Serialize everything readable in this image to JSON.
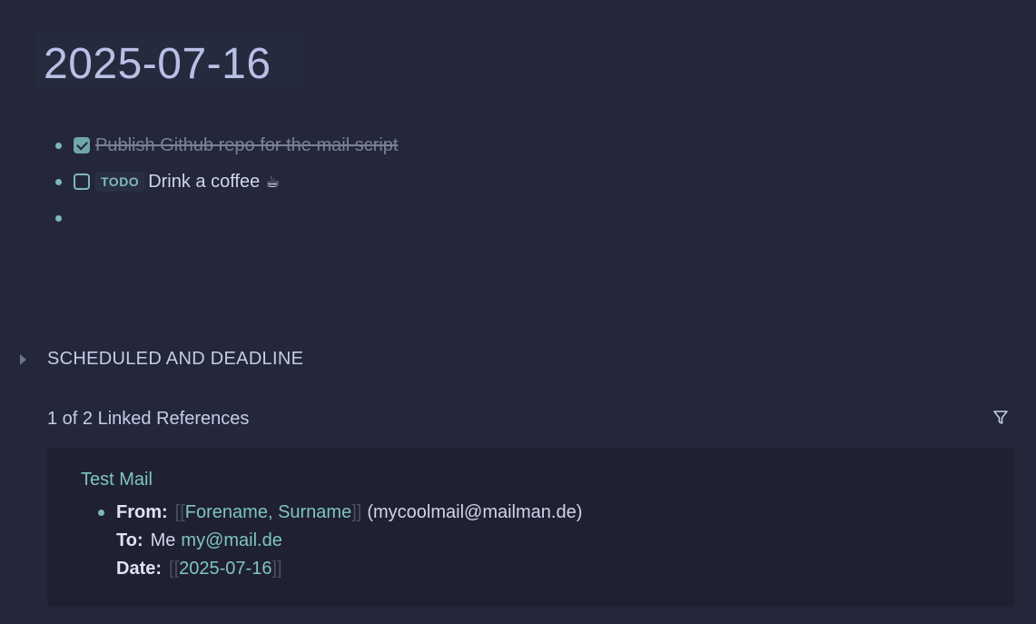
{
  "page": {
    "title": "2025-07-16"
  },
  "blocks": [
    {
      "text": "Publish Github repo for the mail script",
      "done": true
    },
    {
      "tag": "TODO",
      "text": "Drink a coffee",
      "emoji": "☕",
      "done": false
    },
    {
      "text": ""
    }
  ],
  "scheduled": {
    "label": "SCHEDULED AND DEADLINE"
  },
  "linked_refs": {
    "header": "1 of 2 Linked References",
    "card": {
      "title": "Test Mail",
      "from_key": "From:",
      "from_link": "Forename, Surname",
      "from_rest": "(mycoolmail@mailman.de)",
      "to_key": "To:",
      "to_plain": "Me",
      "to_link": "my@mail.de",
      "date_key": "Date:",
      "date_link": "2025-07-16",
      "bracket_open": "[[",
      "bracket_close": "]]"
    }
  },
  "icons": {
    "filter": "filter-icon",
    "collapse": "triangle-right-icon",
    "checked": "checkbox-checked-icon",
    "unchecked": "checkbox-unchecked-icon"
  },
  "colors": {
    "background": "#24273a",
    "accent": "#7fb8ba",
    "card": "#1f2130"
  }
}
